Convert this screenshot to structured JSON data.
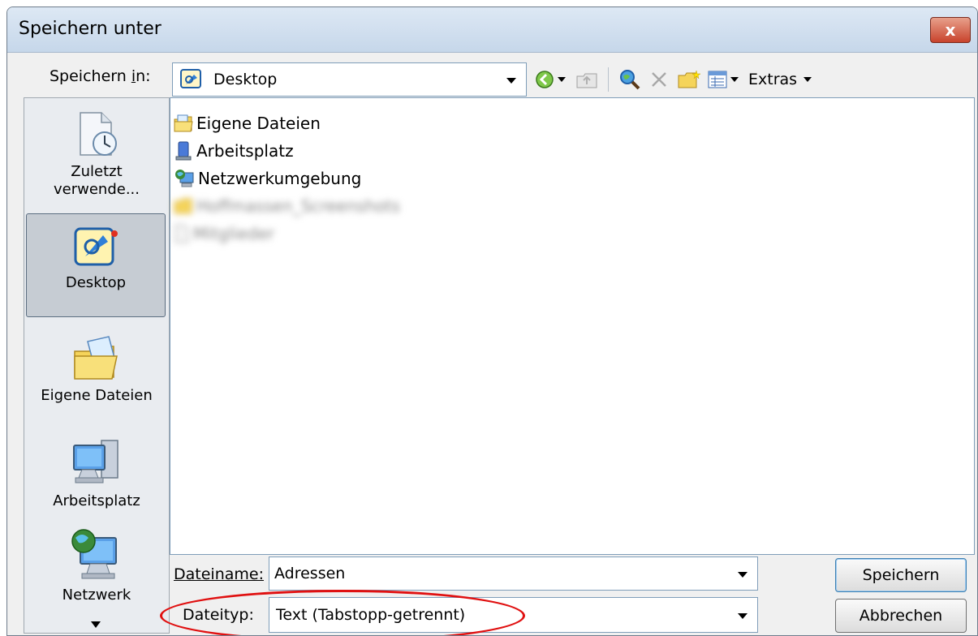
{
  "window": {
    "title": "Speichern unter",
    "close_label": "x"
  },
  "save_in": {
    "label": "Speichern in:",
    "value": "Desktop"
  },
  "toolbar": {
    "extras_label": "Extras"
  },
  "places": [
    {
      "label_line1": "Zuletzt",
      "label_line2": "verwende..."
    },
    {
      "label_line1": "Desktop"
    },
    {
      "label_line1": "Eigene Dateien"
    },
    {
      "label_line1": "Arbeitsplatz"
    },
    {
      "label_line1": "Netzwerk"
    }
  ],
  "files": [
    {
      "name": "Eigene Dateien"
    },
    {
      "name": "Arbeitsplatz"
    },
    {
      "name": "Netzwerkumgebung"
    },
    {
      "name": "Hoffmassen_Screenshots"
    },
    {
      "name": "Mitglieder"
    }
  ],
  "filename": {
    "label": "Dateiname:",
    "value": "Adressen"
  },
  "filetype": {
    "label": "Dateityp:",
    "value": "Text (Tabstopp-getrennt)"
  },
  "buttons": {
    "save": "Speichern",
    "cancel": "Abbrechen"
  },
  "colors": {
    "highlight_oval": "#e01010",
    "title_gradient_top": "#dde8f4"
  }
}
